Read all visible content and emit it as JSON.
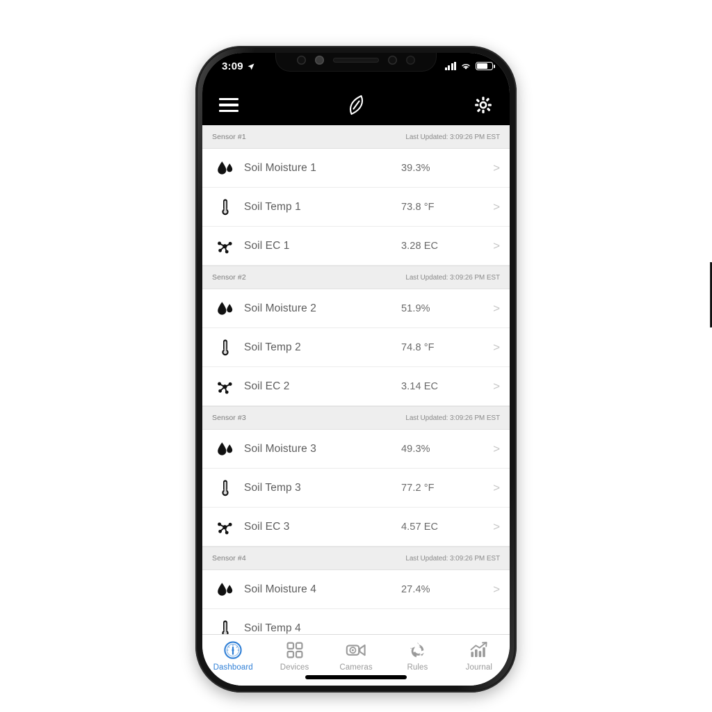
{
  "status_bar": {
    "time": "3:09",
    "location_icon": "location-arrow-icon",
    "signal_icon": "cellular-signal-icon",
    "wifi_icon": "wifi-icon",
    "battery_icon": "battery-icon"
  },
  "nav_bar": {
    "menu_icon": "hamburger-menu-icon",
    "logo_icon": "leaf-logo-icon",
    "settings_icon": "gear-icon"
  },
  "sensors": [
    {
      "name": "Sensor #1",
      "last_updated": "Last Updated: 3:09:26 PM EST",
      "readings": [
        {
          "icon": "water-droplet-icon",
          "label": "Soil Moisture 1",
          "value": "39.3%",
          "chevron": ">"
        },
        {
          "icon": "thermometer-icon",
          "label": "Soil Temp 1",
          "value": "73.8 °F",
          "chevron": ">"
        },
        {
          "icon": "molecule-icon",
          "label": "Soil EC 1",
          "value": "3.28 EC",
          "chevron": ">"
        }
      ]
    },
    {
      "name": "Sensor #2",
      "last_updated": "Last Updated: 3:09:26 PM EST",
      "readings": [
        {
          "icon": "water-droplet-icon",
          "label": "Soil Moisture 2",
          "value": "51.9%",
          "chevron": ">"
        },
        {
          "icon": "thermometer-icon",
          "label": "Soil Temp 2",
          "value": "74.8 °F",
          "chevron": ">"
        },
        {
          "icon": "molecule-icon",
          "label": "Soil EC 2",
          "value": "3.14 EC",
          "chevron": ">"
        }
      ]
    },
    {
      "name": "Sensor #3",
      "last_updated": "Last Updated: 3:09:26 PM EST",
      "readings": [
        {
          "icon": "water-droplet-icon",
          "label": "Soil Moisture 3",
          "value": "49.3%",
          "chevron": ">"
        },
        {
          "icon": "thermometer-icon",
          "label": "Soil Temp 3",
          "value": "77.2 °F",
          "chevron": ">"
        },
        {
          "icon": "molecule-icon",
          "label": "Soil EC 3",
          "value": "4.57 EC",
          "chevron": ">"
        }
      ]
    },
    {
      "name": "Sensor #4",
      "last_updated": "Last Updated: 3:09:26 PM EST",
      "readings": [
        {
          "icon": "water-droplet-icon",
          "label": "Soil Moisture 4",
          "value": "27.4%",
          "chevron": ">"
        },
        {
          "icon": "thermometer-icon",
          "label": "Soil Temp 4",
          "value": "",
          "chevron": ""
        }
      ]
    }
  ],
  "tab_bar": {
    "tabs": [
      {
        "label": "Dashboard",
        "icon": "gauge-icon",
        "active": true
      },
      {
        "label": "Devices",
        "icon": "grid-squares-icon",
        "active": false
      },
      {
        "label": "Cameras",
        "icon": "video-camera-icon",
        "active": false
      },
      {
        "label": "Rules",
        "icon": "recycle-arrows-icon",
        "active": false
      },
      {
        "label": "Journal",
        "icon": "bar-chart-trend-icon",
        "active": false
      }
    ]
  },
  "colors": {
    "accent": "#2f7fd6",
    "group_header_bg": "#eeeeee",
    "nav_bg": "#000000",
    "row_label": "#5d5d5d",
    "row_value": "#6a6a6a",
    "chevron": "#c6c6c6",
    "tab_inactive": "#9a9a9a"
  }
}
